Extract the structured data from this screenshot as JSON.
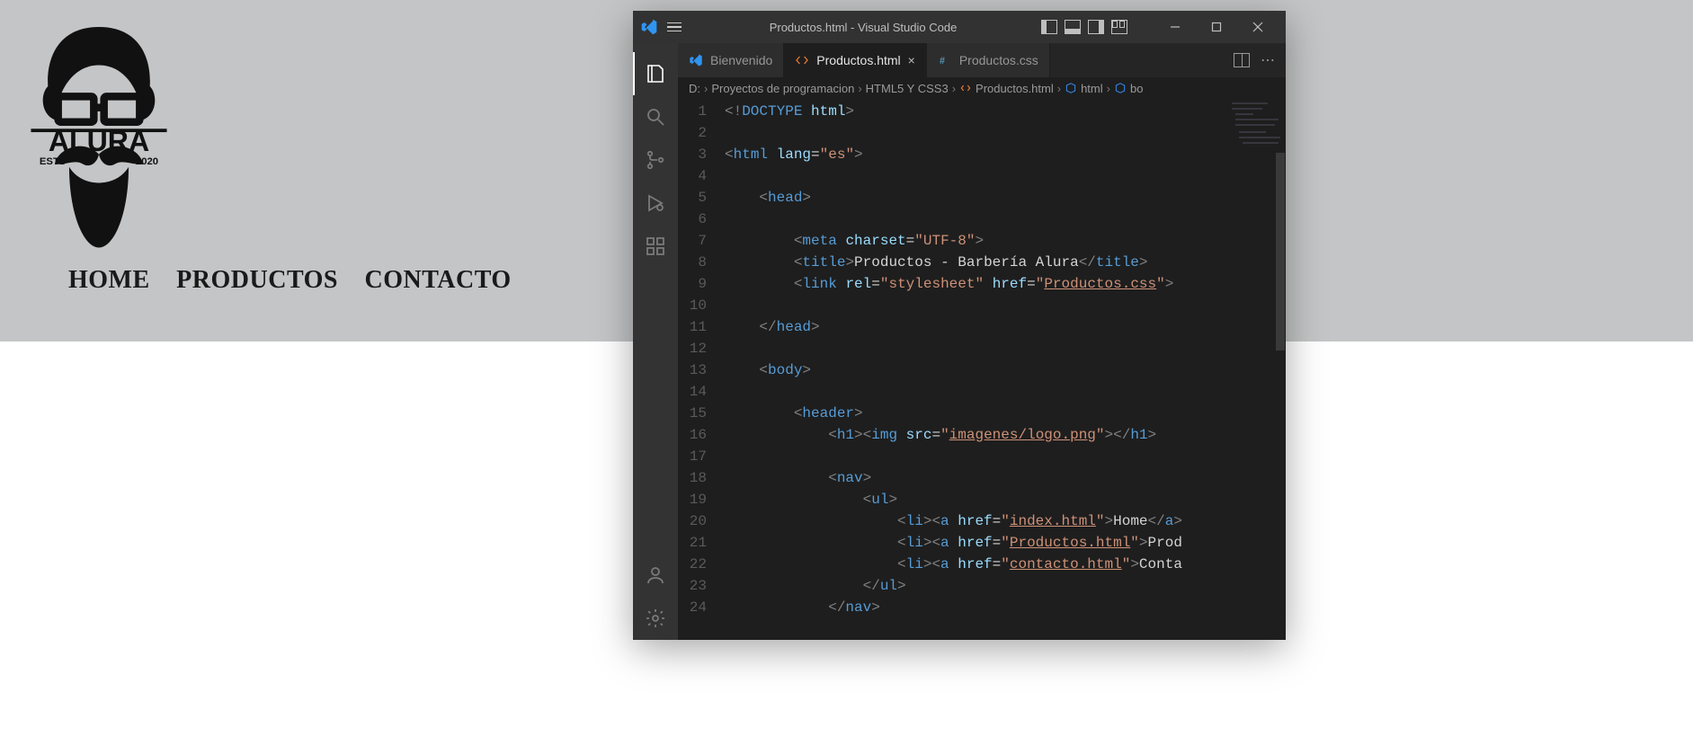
{
  "browser_page": {
    "logo_text_top": "ALURA",
    "logo_estd": "ESTD",
    "logo_year": "2020",
    "nav": [
      "HOME",
      "PRODUCTOS",
      "CONTACTO"
    ]
  },
  "vscode": {
    "title": "Productos.html - Visual Studio Code",
    "tabs": [
      {
        "label": "Bienvenido",
        "type": "welcome",
        "active": false
      },
      {
        "label": "Productos.html",
        "type": "html",
        "active": true,
        "closeable": true
      },
      {
        "label": "Productos.css",
        "type": "css",
        "active": false
      }
    ],
    "breadcrumb": {
      "drive": "D:",
      "parts": [
        "Proyectos de programacion",
        "HTML5 Y CSS3",
        "Productos.html",
        "html",
        "bo"
      ],
      "types": [
        "folder",
        "folder",
        "html",
        "cube",
        "cube"
      ]
    },
    "code": {
      "lines": [
        {
          "n": 1,
          "segments": [
            {
              "t": "<!",
              "c": "gray"
            },
            {
              "t": "DOCTYPE ",
              "c": "tag"
            },
            {
              "t": "html",
              "c": "attr"
            },
            {
              "t": ">",
              "c": "gray"
            }
          ]
        },
        {
          "n": 2,
          "segments": []
        },
        {
          "n": 3,
          "segments": [
            {
              "t": "<",
              "c": "gray"
            },
            {
              "t": "html ",
              "c": "tag"
            },
            {
              "t": "lang",
              "c": "attr"
            },
            {
              "t": "=",
              "c": "text"
            },
            {
              "t": "\"es\"",
              "c": "str"
            },
            {
              "t": ">",
              "c": "gray"
            }
          ]
        },
        {
          "n": 4,
          "segments": []
        },
        {
          "n": 5,
          "segments": [
            {
              "t": "    ",
              "c": "text"
            },
            {
              "t": "<",
              "c": "gray"
            },
            {
              "t": "head",
              "c": "tag"
            },
            {
              "t": ">",
              "c": "gray"
            }
          ]
        },
        {
          "n": 6,
          "segments": []
        },
        {
          "n": 7,
          "segments": [
            {
              "t": "        ",
              "c": "text"
            },
            {
              "t": "<",
              "c": "gray"
            },
            {
              "t": "meta ",
              "c": "tag"
            },
            {
              "t": "charset",
              "c": "attr"
            },
            {
              "t": "=",
              "c": "text"
            },
            {
              "t": "\"UTF-8\"",
              "c": "str"
            },
            {
              "t": ">",
              "c": "gray"
            }
          ]
        },
        {
          "n": 8,
          "segments": [
            {
              "t": "        ",
              "c": "text"
            },
            {
              "t": "<",
              "c": "gray"
            },
            {
              "t": "title",
              "c": "tag"
            },
            {
              "t": ">",
              "c": "gray"
            },
            {
              "t": "Productos - Barbería Alura",
              "c": "text"
            },
            {
              "t": "</",
              "c": "gray"
            },
            {
              "t": "title",
              "c": "tag"
            },
            {
              "t": ">",
              "c": "gray"
            }
          ]
        },
        {
          "n": 9,
          "segments": [
            {
              "t": "        ",
              "c": "text"
            },
            {
              "t": "<",
              "c": "gray"
            },
            {
              "t": "link ",
              "c": "tag"
            },
            {
              "t": "rel",
              "c": "attr"
            },
            {
              "t": "=",
              "c": "text"
            },
            {
              "t": "\"stylesheet\" ",
              "c": "str"
            },
            {
              "t": "href",
              "c": "attr"
            },
            {
              "t": "=",
              "c": "text"
            },
            {
              "t": "\"",
              "c": "str"
            },
            {
              "t": "Productos.css",
              "c": "str-u"
            },
            {
              "t": "\"",
              "c": "str"
            },
            {
              "t": ">",
              "c": "gray"
            }
          ]
        },
        {
          "n": 10,
          "segments": []
        },
        {
          "n": 11,
          "segments": [
            {
              "t": "    ",
              "c": "text"
            },
            {
              "t": "</",
              "c": "gray"
            },
            {
              "t": "head",
              "c": "tag"
            },
            {
              "t": ">",
              "c": "gray"
            }
          ]
        },
        {
          "n": 12,
          "segments": []
        },
        {
          "n": 13,
          "segments": [
            {
              "t": "    ",
              "c": "text"
            },
            {
              "t": "<",
              "c": "gray"
            },
            {
              "t": "body",
              "c": "tag"
            },
            {
              "t": ">",
              "c": "gray"
            }
          ]
        },
        {
          "n": 14,
          "segments": []
        },
        {
          "n": 15,
          "segments": [
            {
              "t": "        ",
              "c": "text"
            },
            {
              "t": "<",
              "c": "gray"
            },
            {
              "t": "header",
              "c": "tag"
            },
            {
              "t": ">",
              "c": "gray"
            }
          ]
        },
        {
          "n": 16,
          "segments": [
            {
              "t": "            ",
              "c": "text"
            },
            {
              "t": "<",
              "c": "gray"
            },
            {
              "t": "h1",
              "c": "tag"
            },
            {
              "t": "><",
              "c": "gray"
            },
            {
              "t": "img ",
              "c": "tag"
            },
            {
              "t": "src",
              "c": "attr"
            },
            {
              "t": "=",
              "c": "text"
            },
            {
              "t": "\"",
              "c": "str"
            },
            {
              "t": "imagenes/logo.png",
              "c": "str-u"
            },
            {
              "t": "\"",
              "c": "str"
            },
            {
              "t": "></",
              "c": "gray"
            },
            {
              "t": "h1",
              "c": "tag"
            },
            {
              "t": ">",
              "c": "gray"
            }
          ]
        },
        {
          "n": 17,
          "segments": []
        },
        {
          "n": 18,
          "segments": [
            {
              "t": "            ",
              "c": "text"
            },
            {
              "t": "<",
              "c": "gray"
            },
            {
              "t": "nav",
              "c": "tag"
            },
            {
              "t": ">",
              "c": "gray"
            }
          ]
        },
        {
          "n": 19,
          "segments": [
            {
              "t": "                ",
              "c": "text"
            },
            {
              "t": "<",
              "c": "gray"
            },
            {
              "t": "ul",
              "c": "tag"
            },
            {
              "t": ">",
              "c": "gray"
            }
          ]
        },
        {
          "n": 20,
          "segments": [
            {
              "t": "                    ",
              "c": "text"
            },
            {
              "t": "<",
              "c": "gray"
            },
            {
              "t": "li",
              "c": "tag"
            },
            {
              "t": "><",
              "c": "gray"
            },
            {
              "t": "a ",
              "c": "tag"
            },
            {
              "t": "href",
              "c": "attr"
            },
            {
              "t": "=",
              "c": "text"
            },
            {
              "t": "\"",
              "c": "str"
            },
            {
              "t": "index.html",
              "c": "str-u"
            },
            {
              "t": "\"",
              "c": "str"
            },
            {
              "t": ">",
              "c": "gray"
            },
            {
              "t": "Home",
              "c": "text"
            },
            {
              "t": "</",
              "c": "gray"
            },
            {
              "t": "a",
              "c": "tag"
            },
            {
              "t": ">",
              "c": "gray"
            }
          ]
        },
        {
          "n": 21,
          "segments": [
            {
              "t": "                    ",
              "c": "text"
            },
            {
              "t": "<",
              "c": "gray"
            },
            {
              "t": "li",
              "c": "tag"
            },
            {
              "t": "><",
              "c": "gray"
            },
            {
              "t": "a ",
              "c": "tag"
            },
            {
              "t": "href",
              "c": "attr"
            },
            {
              "t": "=",
              "c": "text"
            },
            {
              "t": "\"",
              "c": "str"
            },
            {
              "t": "Productos.html",
              "c": "str-u"
            },
            {
              "t": "\"",
              "c": "str"
            },
            {
              "t": ">",
              "c": "gray"
            },
            {
              "t": "Prod",
              "c": "text"
            }
          ]
        },
        {
          "n": 22,
          "segments": [
            {
              "t": "                    ",
              "c": "text"
            },
            {
              "t": "<",
              "c": "gray"
            },
            {
              "t": "li",
              "c": "tag"
            },
            {
              "t": "><",
              "c": "gray"
            },
            {
              "t": "a ",
              "c": "tag"
            },
            {
              "t": "href",
              "c": "attr"
            },
            {
              "t": "=",
              "c": "text"
            },
            {
              "t": "\"",
              "c": "str"
            },
            {
              "t": "contacto.html",
              "c": "str-u"
            },
            {
              "t": "\"",
              "c": "str"
            },
            {
              "t": ">",
              "c": "gray"
            },
            {
              "t": "Conta",
              "c": "text"
            }
          ]
        },
        {
          "n": 23,
          "segments": [
            {
              "t": "                ",
              "c": "text"
            },
            {
              "t": "</",
              "c": "gray"
            },
            {
              "t": "ul",
              "c": "tag"
            },
            {
              "t": ">",
              "c": "gray"
            }
          ]
        },
        {
          "n": 24,
          "segments": [
            {
              "t": "            ",
              "c": "text"
            },
            {
              "t": "</",
              "c": "gray"
            },
            {
              "t": "nav",
              "c": "tag"
            },
            {
              "t": ">",
              "c": "gray"
            }
          ]
        }
      ]
    }
  }
}
